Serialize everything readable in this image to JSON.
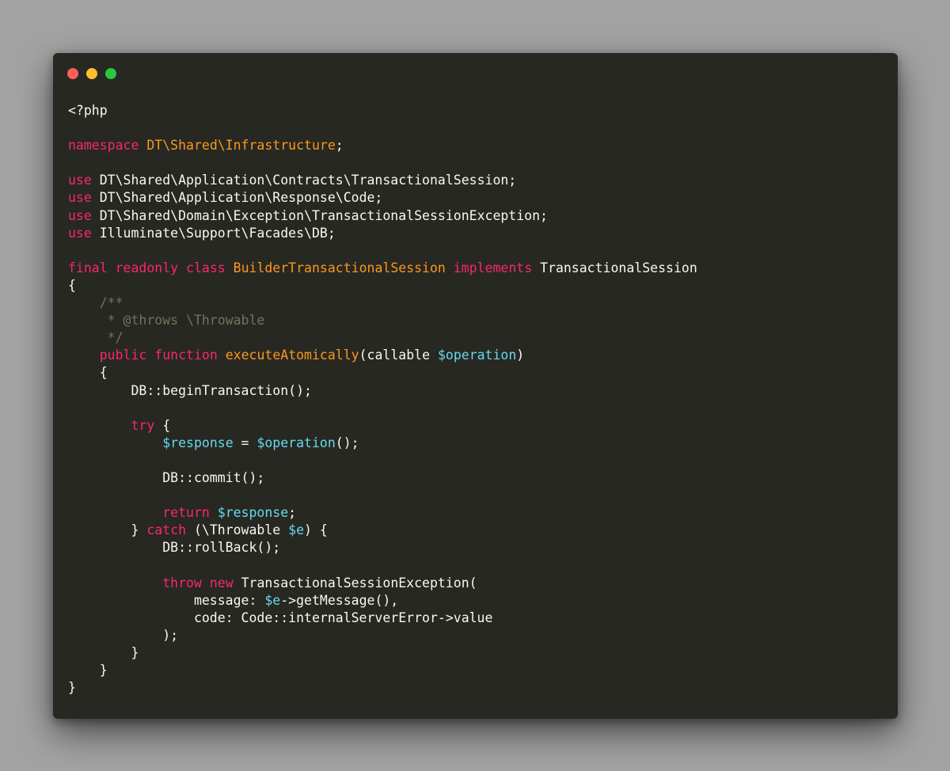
{
  "window": {
    "buttons": [
      {
        "name": "close",
        "color": "#ff5f56"
      },
      {
        "name": "minimize",
        "color": "#ffbd2e"
      },
      {
        "name": "maximize",
        "color": "#27c93f"
      }
    ]
  },
  "theme": {
    "background": "#272822",
    "page_background": "#a3a3a3",
    "keyword": "#f92672",
    "type": "#fd971f",
    "variable": "#66d9ef",
    "comment": "#75715e",
    "plain": "#f8f8f2"
  },
  "code": {
    "language": "php",
    "lines": [
      [
        {
          "t": "<?php",
          "c": "pl"
        }
      ],
      [],
      [
        {
          "t": "namespace",
          "c": "kw"
        },
        {
          "t": " ",
          "c": "pl"
        },
        {
          "t": "DT\\Shared\\Infrastructure",
          "c": "ty"
        },
        {
          "t": ";",
          "c": "pl"
        }
      ],
      [],
      [
        {
          "t": "use",
          "c": "kw"
        },
        {
          "t": " DT\\Shared\\Application\\Contracts\\TransactionalSession;",
          "c": "pl"
        }
      ],
      [
        {
          "t": "use",
          "c": "kw"
        },
        {
          "t": " DT\\Shared\\Application\\Response\\Code;",
          "c": "pl"
        }
      ],
      [
        {
          "t": "use",
          "c": "kw"
        },
        {
          "t": " DT\\Shared\\Domain\\Exception\\TransactionalSessionException;",
          "c": "pl"
        }
      ],
      [
        {
          "t": "use",
          "c": "kw"
        },
        {
          "t": " Illuminate\\Support\\Facades\\DB;",
          "c": "pl"
        }
      ],
      [],
      [
        {
          "t": "final",
          "c": "kw"
        },
        {
          "t": " ",
          "c": "pl"
        },
        {
          "t": "readonly",
          "c": "kw"
        },
        {
          "t": " ",
          "c": "pl"
        },
        {
          "t": "class",
          "c": "kw"
        },
        {
          "t": " ",
          "c": "pl"
        },
        {
          "t": "BuilderTransactionalSession",
          "c": "ty"
        },
        {
          "t": " ",
          "c": "pl"
        },
        {
          "t": "implements",
          "c": "kw"
        },
        {
          "t": " TransactionalSession",
          "c": "pl"
        }
      ],
      [
        {
          "t": "{",
          "c": "pl"
        }
      ],
      [
        {
          "t": "    ",
          "c": "pl"
        },
        {
          "t": "/**",
          "c": "cm"
        }
      ],
      [
        {
          "t": "     ",
          "c": "pl"
        },
        {
          "t": "* @throws \\Throwable",
          "c": "cm"
        }
      ],
      [
        {
          "t": "     ",
          "c": "pl"
        },
        {
          "t": "*/",
          "c": "cm"
        }
      ],
      [
        {
          "t": "    ",
          "c": "pl"
        },
        {
          "t": "public",
          "c": "kw"
        },
        {
          "t": " ",
          "c": "pl"
        },
        {
          "t": "function",
          "c": "kw"
        },
        {
          "t": " ",
          "c": "pl"
        },
        {
          "t": "executeAtomically",
          "c": "fn"
        },
        {
          "t": "(callable ",
          "c": "pl"
        },
        {
          "t": "$operation",
          "c": "var"
        },
        {
          "t": ")",
          "c": "pl"
        }
      ],
      [
        {
          "t": "    {",
          "c": "pl"
        }
      ],
      [
        {
          "t": "        DB::beginTransaction();",
          "c": "pl"
        }
      ],
      [],
      [
        {
          "t": "        ",
          "c": "pl"
        },
        {
          "t": "try",
          "c": "kw"
        },
        {
          "t": " {",
          "c": "pl"
        }
      ],
      [
        {
          "t": "            ",
          "c": "pl"
        },
        {
          "t": "$response",
          "c": "var"
        },
        {
          "t": " = ",
          "c": "pl"
        },
        {
          "t": "$operation",
          "c": "var"
        },
        {
          "t": "();",
          "c": "pl"
        }
      ],
      [],
      [
        {
          "t": "            DB::commit();",
          "c": "pl"
        }
      ],
      [],
      [
        {
          "t": "            ",
          "c": "pl"
        },
        {
          "t": "return",
          "c": "kw"
        },
        {
          "t": " ",
          "c": "pl"
        },
        {
          "t": "$response",
          "c": "var"
        },
        {
          "t": ";",
          "c": "pl"
        }
      ],
      [
        {
          "t": "        } ",
          "c": "pl"
        },
        {
          "t": "catch",
          "c": "kw"
        },
        {
          "t": " (\\Throwable ",
          "c": "pl"
        },
        {
          "t": "$e",
          "c": "var"
        },
        {
          "t": ") {",
          "c": "pl"
        }
      ],
      [
        {
          "t": "            DB::rollBack();",
          "c": "pl"
        }
      ],
      [],
      [
        {
          "t": "            ",
          "c": "pl"
        },
        {
          "t": "throw",
          "c": "kw"
        },
        {
          "t": " ",
          "c": "pl"
        },
        {
          "t": "new",
          "c": "kw"
        },
        {
          "t": " TransactionalSessionException(",
          "c": "pl"
        }
      ],
      [
        {
          "t": "                message: ",
          "c": "pl"
        },
        {
          "t": "$e",
          "c": "var"
        },
        {
          "t": "->getMessage(),",
          "c": "pl"
        }
      ],
      [
        {
          "t": "                code: Code::internalServerError->value",
          "c": "pl"
        }
      ],
      [
        {
          "t": "            );",
          "c": "pl"
        }
      ],
      [
        {
          "t": "        }",
          "c": "pl"
        }
      ],
      [
        {
          "t": "    }",
          "c": "pl"
        }
      ],
      [
        {
          "t": "}",
          "c": "pl"
        }
      ]
    ]
  }
}
